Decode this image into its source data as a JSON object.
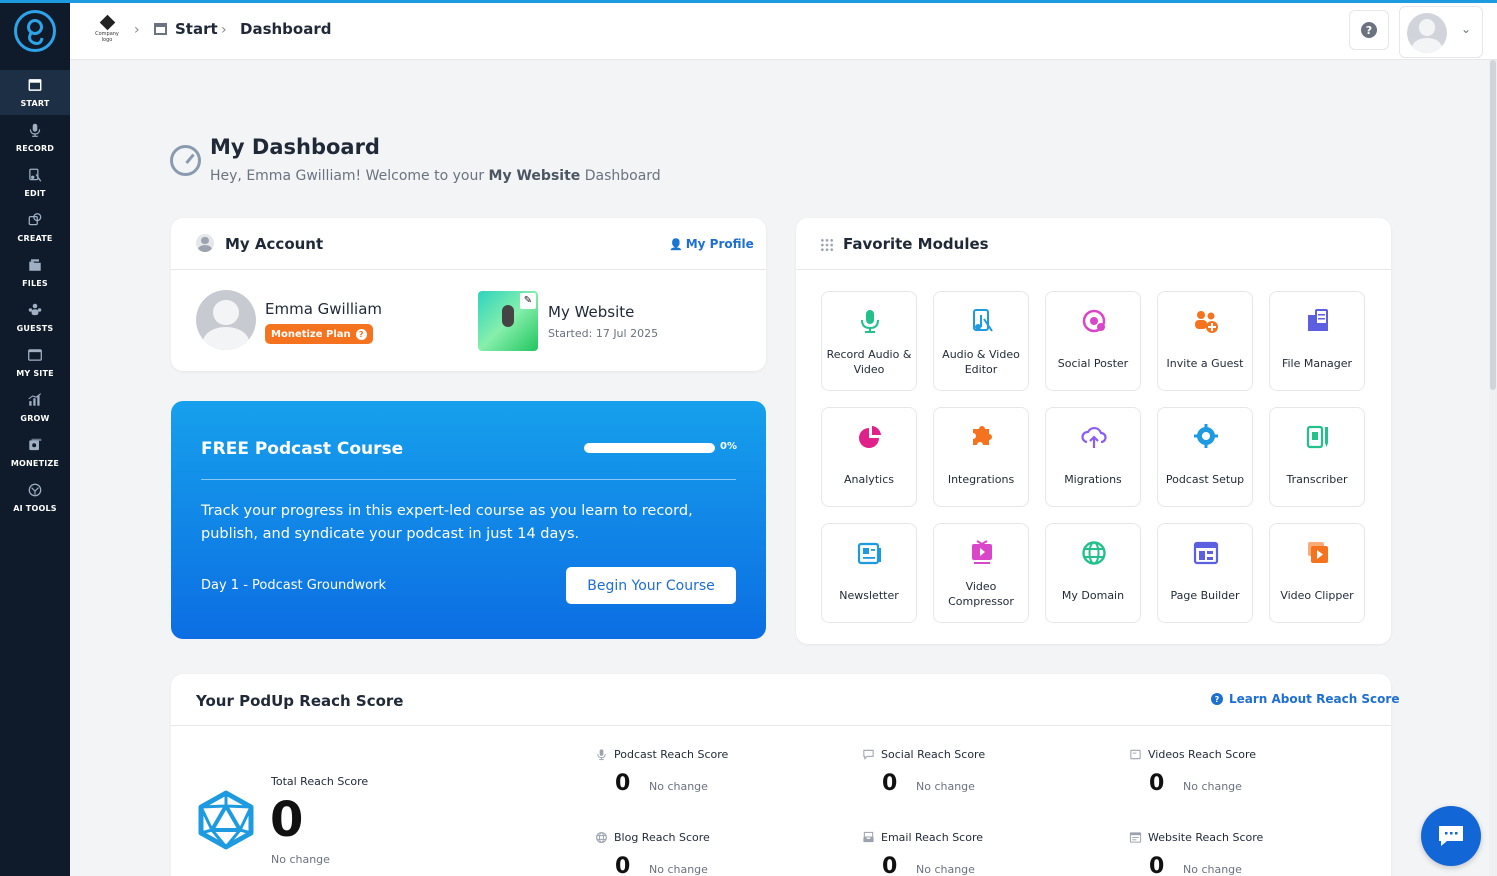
{
  "sidebar": {
    "items": [
      {
        "label": "START",
        "icon": "start-icon",
        "active": true
      },
      {
        "label": "RECORD",
        "icon": "mic-icon"
      },
      {
        "label": "EDIT",
        "icon": "edit-icon"
      },
      {
        "label": "CREATE",
        "icon": "create-icon"
      },
      {
        "label": "FILES",
        "icon": "files-icon"
      },
      {
        "label": "GUESTS",
        "icon": "guests-icon"
      },
      {
        "label": "MY SITE",
        "icon": "site-icon"
      },
      {
        "label": "GROW",
        "icon": "chart-icon"
      },
      {
        "label": "MONETIZE",
        "icon": "monetize-icon"
      },
      {
        "label": "AI TOOLS",
        "icon": "ai-icon"
      }
    ]
  },
  "header": {
    "company_logo_line1": "Company",
    "company_logo_line2": "logo",
    "breadcrumb_start": "Start",
    "breadcrumb_current": "Dashboard"
  },
  "page": {
    "title": "My Dashboard",
    "subtitle_prefix": "Hey, Emma Gwilliam! Welcome to your ",
    "subtitle_site": "My Website",
    "subtitle_suffix": " Dashboard"
  },
  "account": {
    "title": "My Account",
    "profile_link": "My Profile",
    "name": "Emma Gwilliam",
    "plan": "Monetize Plan",
    "site_name": "My Website",
    "site_started": "Started: 17 Jul 2025"
  },
  "course": {
    "title": "FREE Podcast Course",
    "progress": 0,
    "progress_label": "0%",
    "description": "Track your progress in this expert-led course as you learn to record, publish, and syndicate your podcast in just 14 days.",
    "day": "Day 1 - Podcast Groundwork",
    "button": "Begin Your Course"
  },
  "favorites": {
    "title": "Favorite Modules",
    "modules": [
      {
        "label": "Record Audio & Video",
        "icon": "mic-icon",
        "color": "#22c08a"
      },
      {
        "label": "Audio & Video Editor",
        "icon": "audio-editor-icon",
        "color": "#1e9be0"
      },
      {
        "label": "Social Poster",
        "icon": "social-poster-icon",
        "color": "#d946c7"
      },
      {
        "label": "Invite a Guest",
        "icon": "invite-guest-icon",
        "color": "#f5731e"
      },
      {
        "label": "File Manager",
        "icon": "file-manager-icon",
        "color": "#5b5fe0"
      },
      {
        "label": "Analytics",
        "icon": "pie-chart-icon",
        "color": "#e0218a"
      },
      {
        "label": "Integrations",
        "icon": "puzzle-icon",
        "color": "#f5731e"
      },
      {
        "label": "Migrations",
        "icon": "cloud-upload-icon",
        "color": "#8b5cf6"
      },
      {
        "label": "Podcast Setup",
        "icon": "gear-icon",
        "color": "#1e9be0"
      },
      {
        "label": "Transcriber",
        "icon": "transcriber-icon",
        "color": "#22c08a"
      },
      {
        "label": "Newsletter",
        "icon": "newsletter-icon",
        "color": "#1e9be0"
      },
      {
        "label": "Video Compressor",
        "icon": "video-compressor-icon",
        "color": "#d946c7"
      },
      {
        "label": "My Domain",
        "icon": "globe-icon",
        "color": "#22c08a"
      },
      {
        "label": "Page Builder",
        "icon": "page-builder-icon",
        "color": "#5b5fe0"
      },
      {
        "label": "Video Clipper",
        "icon": "video-clipper-icon",
        "color": "#f5731e"
      }
    ]
  },
  "reach": {
    "title": "Your PodUp Reach Score",
    "learn_link": "Learn About Reach Score",
    "total_label": "Total Reach Score",
    "total_value": "0",
    "total_change": "No change",
    "scores": [
      {
        "label": "Podcast Reach Score",
        "value": "0",
        "change": "No change",
        "icon": "mic-icon"
      },
      {
        "label": "Social Reach Score",
        "value": "0",
        "change": "No change",
        "icon": "chat-icon"
      },
      {
        "label": "Videos Reach Score",
        "value": "0",
        "change": "No change",
        "icon": "video-icon"
      },
      {
        "label": "Blog Reach Score",
        "value": "0",
        "change": "No change",
        "icon": "globe-icon"
      },
      {
        "label": "Email Reach Score",
        "value": "0",
        "change": "No change",
        "icon": "inbox-icon"
      },
      {
        "label": "Website Reach Score",
        "value": "0",
        "change": "No change",
        "icon": "browser-icon"
      }
    ]
  },
  "colors": {
    "sidebar_bg": "#0f1b2a",
    "accent": "#1d6fd1",
    "plan_badge": "#f5731e",
    "course_gradient_top": "#16a0ec",
    "course_gradient_bottom": "#0c6ee3"
  }
}
